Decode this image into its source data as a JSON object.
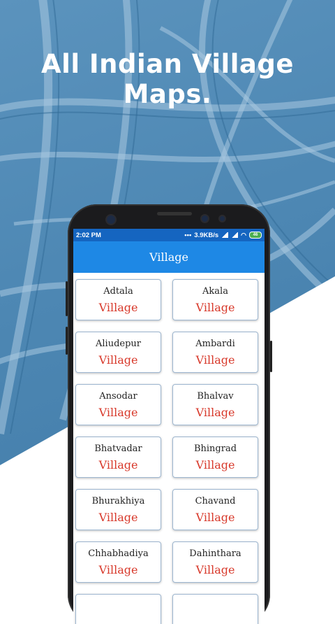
{
  "promo": {
    "headline": "All Indian Village Maps."
  },
  "status_bar": {
    "time": "2:02 PM",
    "network_speed": "3.9KB/s",
    "battery": "46"
  },
  "app_bar": {
    "title": "Village"
  },
  "villages": [
    {
      "name": "Adtala",
      "type": "Village"
    },
    {
      "name": "Akala",
      "type": "Village"
    },
    {
      "name": "Aliudepur",
      "type": "Village"
    },
    {
      "name": "Ambardi",
      "type": "Village"
    },
    {
      "name": "Ansodar",
      "type": "Village"
    },
    {
      "name": "Bhalvav",
      "type": "Village"
    },
    {
      "name": "Bhatvadar",
      "type": "Village"
    },
    {
      "name": "Bhingrad",
      "type": "Village"
    },
    {
      "name": "Bhurakhiya",
      "type": "Village"
    },
    {
      "name": "Chavand",
      "type": "Village"
    },
    {
      "name": "Chhabhadiya",
      "type": "Village"
    },
    {
      "name": "Dahinthara",
      "type": "Village"
    },
    {
      "name": "",
      "type": ""
    },
    {
      "name": "",
      "type": ""
    }
  ],
  "colors": {
    "app_bar": "#1e88e5",
    "status_bar": "#1565c0",
    "village_label": "#d8392b"
  }
}
